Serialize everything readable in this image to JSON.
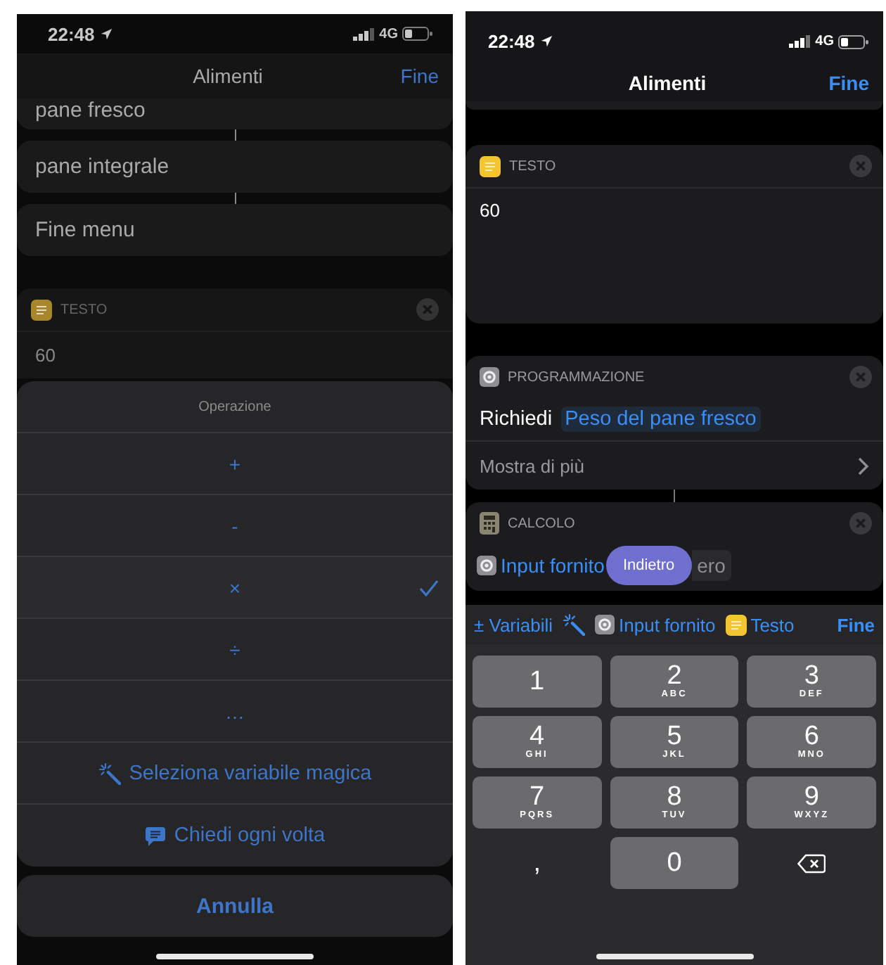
{
  "left_screen": {
    "status_bar": {
      "time": "22:48",
      "network": "4G"
    },
    "nav_bar": {
      "title": "Alimenti",
      "done": "Fine"
    },
    "menu_items": [
      {
        "label": "pane fresco"
      },
      {
        "label": "pane integrale"
      },
      {
        "label": "Fine menu"
      }
    ],
    "text_action": {
      "title": "TESTO",
      "value": "60"
    },
    "action_sheet": {
      "title": "Operazione",
      "options": [
        {
          "label": "+",
          "selected": false
        },
        {
          "label": "-",
          "selected": false
        },
        {
          "label": "×",
          "selected": true
        },
        {
          "label": "÷",
          "selected": false
        },
        {
          "label": "…",
          "selected": false
        }
      ],
      "actions": [
        {
          "kind": "magic",
          "label": "Seleziona variabile magica"
        },
        {
          "kind": "ask",
          "label": "Chiedi ogni volta"
        }
      ],
      "cancel": "Annulla"
    }
  },
  "right_screen": {
    "status_bar": {
      "time": "22:48",
      "network": "4G"
    },
    "nav_bar": {
      "title": "Alimenti",
      "done": "Fine"
    },
    "text_action": {
      "title": "TESTO",
      "value": "60"
    },
    "scripting_action": {
      "title": "PROGRAMMAZIONE",
      "verb": "Richiedi",
      "prompt": "Peso del pane fresco",
      "more": "Mostra di più"
    },
    "calc_action": {
      "title": "CALCOLO",
      "input_token": "Input fornito",
      "tooltip": "Indietro",
      "second_token": "ero"
    },
    "toolbar": {
      "variables": "± Variabili",
      "input_token": "Input fornito",
      "text_token": "Testo",
      "done": "Fine"
    },
    "keypad": [
      {
        "kind": "digit",
        "digit": "1"
      },
      {
        "kind": "digit",
        "digit": "2",
        "letters": "ABC"
      },
      {
        "kind": "digit",
        "digit": "3",
        "letters": "DEF"
      },
      {
        "kind": "digit",
        "digit": "4",
        "letters": "GHI"
      },
      {
        "kind": "digit",
        "digit": "5",
        "letters": "JKL"
      },
      {
        "kind": "digit",
        "digit": "6",
        "letters": "MNO"
      },
      {
        "kind": "digit",
        "digit": "7",
        "letters": "PQRS"
      },
      {
        "kind": "digit",
        "digit": "8",
        "letters": "TUV"
      },
      {
        "kind": "digit",
        "digit": "9",
        "letters": "WXYZ"
      },
      {
        "kind": "symbol",
        "label": ","
      },
      {
        "kind": "digit",
        "digit": "0"
      },
      {
        "kind": "delete"
      }
    ]
  }
}
